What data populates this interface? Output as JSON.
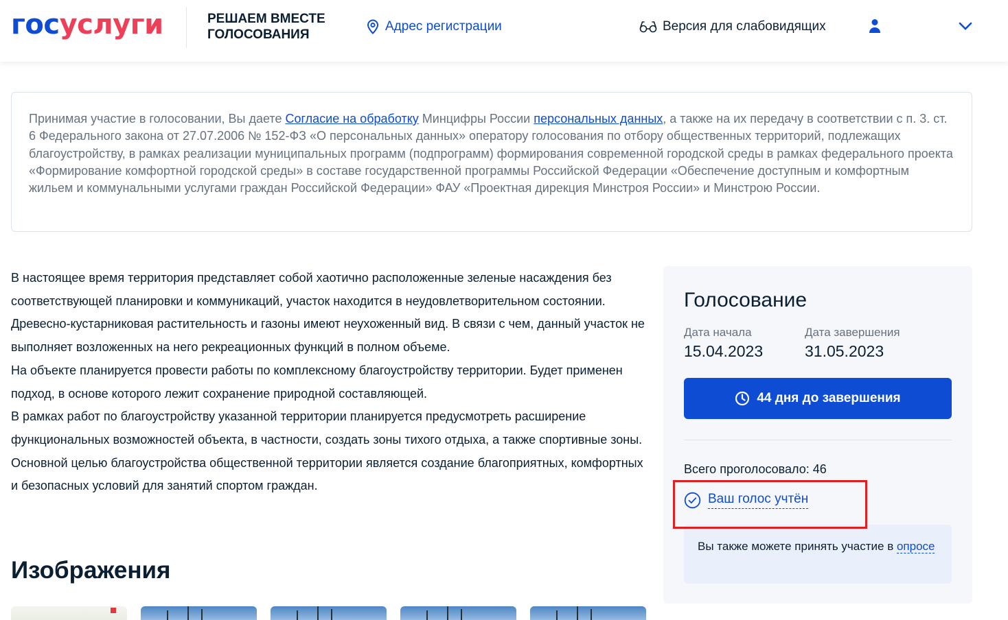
{
  "header": {
    "logo_part1": "гос",
    "logo_part2": "услуги",
    "brand_title": "РЕШАЕМ ВМЕСТЕ ГОЛОСОВАНИЯ",
    "address_link": "Адрес регистрации",
    "vision_link": "Версия для слабовидящих"
  },
  "consent": {
    "t1": "Принимая участие в голосовании, Вы даете ",
    "link1": "Согласие на обработку",
    "t2": " Минцифры России ",
    "link2": "персональных данных",
    "t3": ", а также на их передачу в соответствии с п. 3. ст. 6 Федерального закона от 27.07.2006 № 152-ФЗ «О персональных данных» оператору голосования по отбору общественных территорий, подлежащих благоустройству, в рамках реализации муниципальных программ (подпрограмм) формирования современной городской среды в рамках федерального проекта «Формирование комфортной городской среды» в составе государственной программы Российской Федерации «Обеспечение доступным и комфортным жильем и коммунальными услугами граждан Российской Федерации» ФАУ «Проектная дирекция Минстроя России» и Минстрою России."
  },
  "description": {
    "p1": "В настоящее время территория представляет собой хаотично расположенные зеленые насаждения без соответствующей планировки и коммуникаций, участок находится в неудовлетворительном состоянии. Древесно-кустарниковая растительность и газоны имеют неухоженный вид. В связи с чем, данный участок не выполняет возложенных на него рекреационных функций в полном объеме.",
    "p2": "На объекте планируется провести работы по комплексному благоустройству территории. Будет применен подход, в основе которого лежит сохранение природной составляющей.",
    "p3": "В рамках работ по благоустройству указанной территории планируется предусмотреть расширение функциональных возможностей объекта, в частности, создать зоны тихого отдыха, а также спортивные зоны.",
    "p4": "Основной целью благоустройства общественной территории является создание благоприятных, комфортных и безопасных условий для занятий спортом граждан."
  },
  "images": {
    "title": "Изображения"
  },
  "vote": {
    "title": "Голосование",
    "start_label": "Дата начала",
    "start_value": "15.04.2023",
    "end_label": "Дата завершения",
    "end_value": "31.05.2023",
    "days_button": "44 дня до завершения",
    "total": "Всего проголосовало: 46",
    "voted_status": "Ваш голос учтён",
    "survey_text": "Вы также можете принять участие в ",
    "survey_link": "опросе"
  },
  "colors": {
    "brand_blue": "#0d4cd3",
    "brand_red": "#ee3f58",
    "highlight": "#e02020"
  },
  "icons": [
    "location-pin-icon",
    "glasses-icon",
    "user-icon",
    "chevron-down-icon",
    "clock-icon",
    "check-circle-icon"
  ]
}
